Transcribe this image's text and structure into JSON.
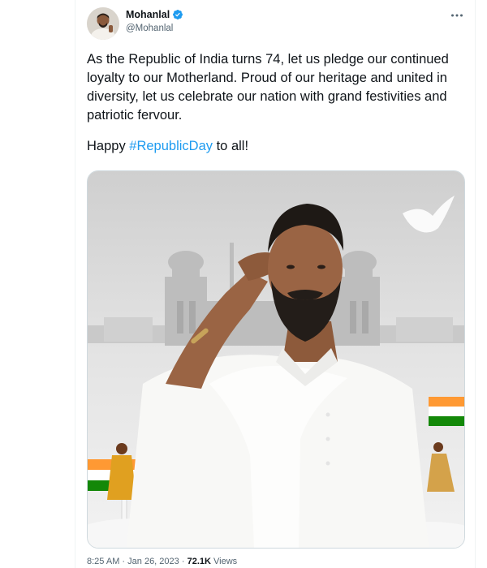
{
  "author": {
    "display_name": "Mohanlal",
    "handle": "@Mohanlal",
    "verified": true,
    "verified_color": "#1d9bf0"
  },
  "tweet": {
    "text_para1": "As the Republic of India turns 74, let us pledge our continued loyalty to our Motherland. Proud of our heritage and united in diversity, let us celebrate our nation with grand festivities and patriotic fervour.",
    "text_para2_prefix": "Happy ",
    "hashtag": "#RepublicDay",
    "text_para2_suffix": " to all!",
    "hashtag_color": "#1d9bf0"
  },
  "meta": {
    "time": "8:25 AM",
    "separator": "·",
    "date": "Jan 26, 2023",
    "views_count": "72.1K",
    "views_label": "Views"
  },
  "icons": {
    "more": "more-horizontal-icon",
    "verified": "verified-badge-icon"
  }
}
